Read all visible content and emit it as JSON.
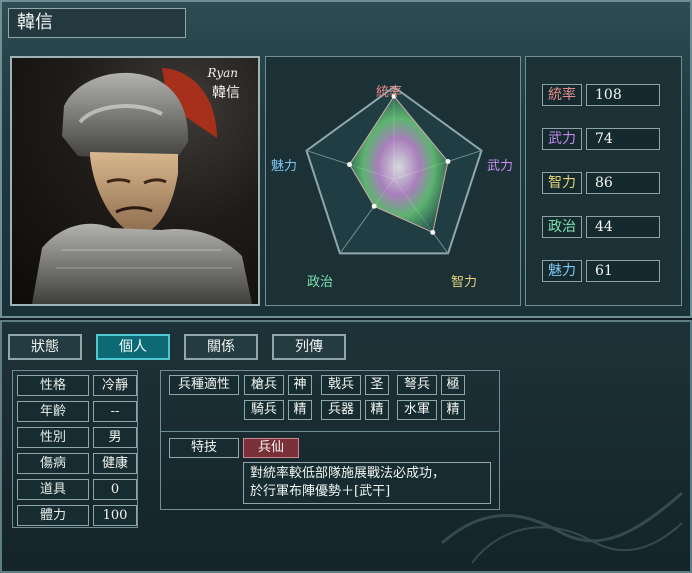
{
  "character": {
    "name": "韓信",
    "portrait_signature": "Ryan",
    "portrait_caption": "韓信"
  },
  "radar": {
    "labels": {
      "leadership": "統率",
      "force": "武力",
      "intelligence": "智力",
      "politics": "政治",
      "charm": "魅力"
    },
    "values": {
      "leadership": 108,
      "force": 74,
      "intelligence": 86,
      "politics": 44,
      "charm": 61
    }
  },
  "stats": [
    {
      "label": "統率",
      "value": "108",
      "color": "#e98a8a"
    },
    {
      "label": "武力",
      "value": "74",
      "color": "#c28ae8"
    },
    {
      "label": "智力",
      "value": "86",
      "color": "#e2d37a"
    },
    {
      "label": "政治",
      "value": "44",
      "color": "#7fe2b1"
    },
    {
      "label": "魅力",
      "value": "61",
      "color": "#7fc6f0"
    }
  ],
  "tabs": [
    {
      "label": "狀態",
      "active": false
    },
    {
      "label": "個人",
      "active": true
    },
    {
      "label": "關係",
      "active": false
    },
    {
      "label": "列傳",
      "active": false
    }
  ],
  "profile": [
    {
      "key": "性格",
      "value": "冷靜"
    },
    {
      "key": "年齡",
      "value": "--"
    },
    {
      "key": "性別",
      "value": "男"
    },
    {
      "key": "傷病",
      "value": "健康"
    },
    {
      "key": "道具",
      "value": "0"
    },
    {
      "key": "體力",
      "value": "100"
    }
  ],
  "unit_aptitude": {
    "title": "兵種適性",
    "items": [
      {
        "unit": "槍兵",
        "grade": "神"
      },
      {
        "unit": "戟兵",
        "grade": "圣"
      },
      {
        "unit": "弩兵",
        "grade": "極"
      },
      {
        "unit": "騎兵",
        "grade": "精"
      },
      {
        "unit": "兵器",
        "grade": "精"
      },
      {
        "unit": "水軍",
        "grade": "精"
      }
    ]
  },
  "skill": {
    "title": "特技",
    "name": "兵仙",
    "description_line1": "對統率較低部隊施展戰法必成功，",
    "description_line2": "於行軍布陣優勢＋[武干]"
  }
}
